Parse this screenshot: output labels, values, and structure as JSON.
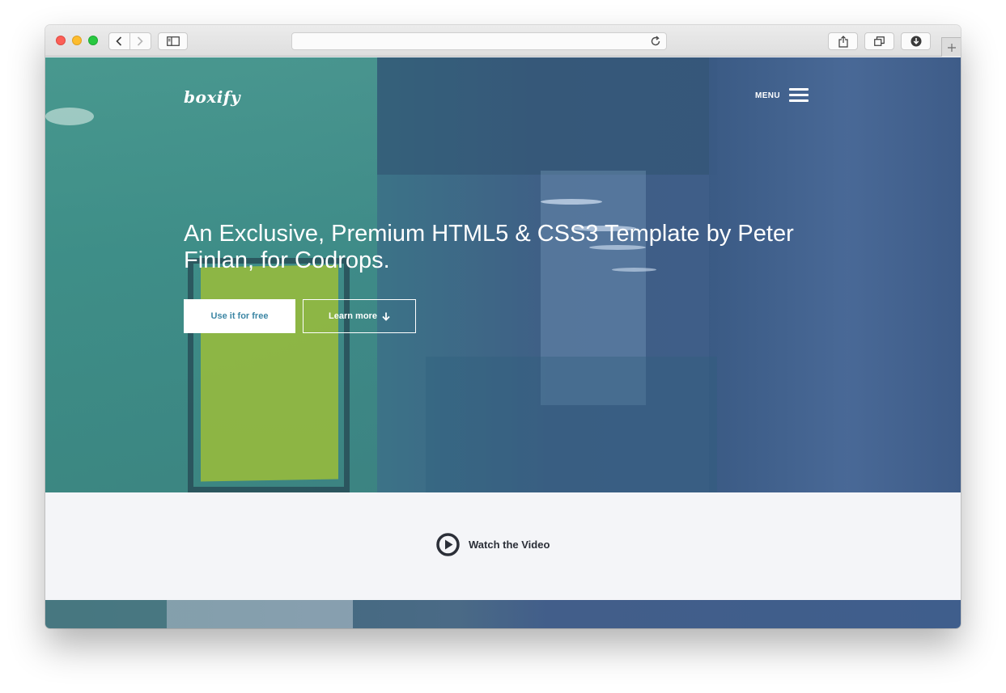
{
  "browser": {
    "url": "",
    "icons": [
      "back-icon",
      "forward-icon",
      "sidebar-icon",
      "reload-icon",
      "share-icon",
      "tabs-icon",
      "download-icon",
      "new-tab-icon"
    ]
  },
  "site": {
    "logo": "boxify",
    "menu_label": "MENU",
    "headline": "An Exclusive, Premium HTML5 & CSS3 Template by Peter Finlan, for Codrops.",
    "primary_button": "Use it for free",
    "secondary_button": "Learn more",
    "video_label": "Watch the Video"
  },
  "colors": {
    "hero_overlay_left": "#3a8d86",
    "hero_overlay_right": "#3f5d8b",
    "primary_button_text": "#3c86a4",
    "video_text": "#2b2f38",
    "section_bg": "#f4f5f8"
  }
}
